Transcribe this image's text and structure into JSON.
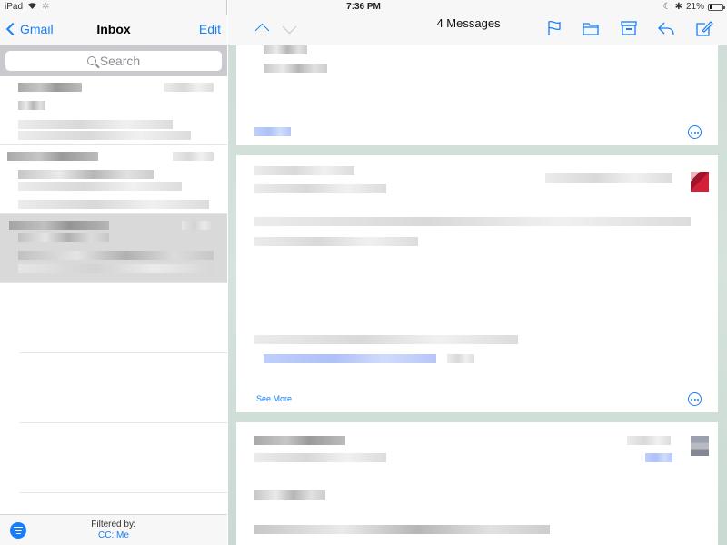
{
  "status_bar": {
    "device": "iPad",
    "time": "7:36 PM",
    "battery": "21%",
    "battery_level": 0.21,
    "icons": [
      "wifi-icon",
      "loading-icon",
      "moon-icon",
      "bluetooth-icon",
      "battery-icon"
    ]
  },
  "mailbox": {
    "back_label": "Gmail",
    "title": "Inbox",
    "edit_label": "Edit",
    "search_placeholder": "Search",
    "items": [
      {
        "redacted": true,
        "selected": false
      },
      {
        "redacted": true,
        "selected": false
      },
      {
        "redacted": true,
        "selected": true
      }
    ],
    "filter": {
      "label": "Filtered by:",
      "value": "CC: Me"
    }
  },
  "thread": {
    "title": "4 Messages",
    "toolbar": [
      "flag-icon",
      "folder-icon",
      "archive-icon",
      "reply-icon",
      "compose-icon"
    ],
    "messages": [
      {
        "redacted": true,
        "has_see_more": false
      },
      {
        "redacted": true,
        "has_see_more": true,
        "see_more_label": "See More"
      },
      {
        "redacted": true,
        "has_see_more": false
      }
    ]
  },
  "colors": {
    "accent": "#157efb",
    "selected_row": "#d9d9d9",
    "bar_bg": "#f7f7f7"
  }
}
